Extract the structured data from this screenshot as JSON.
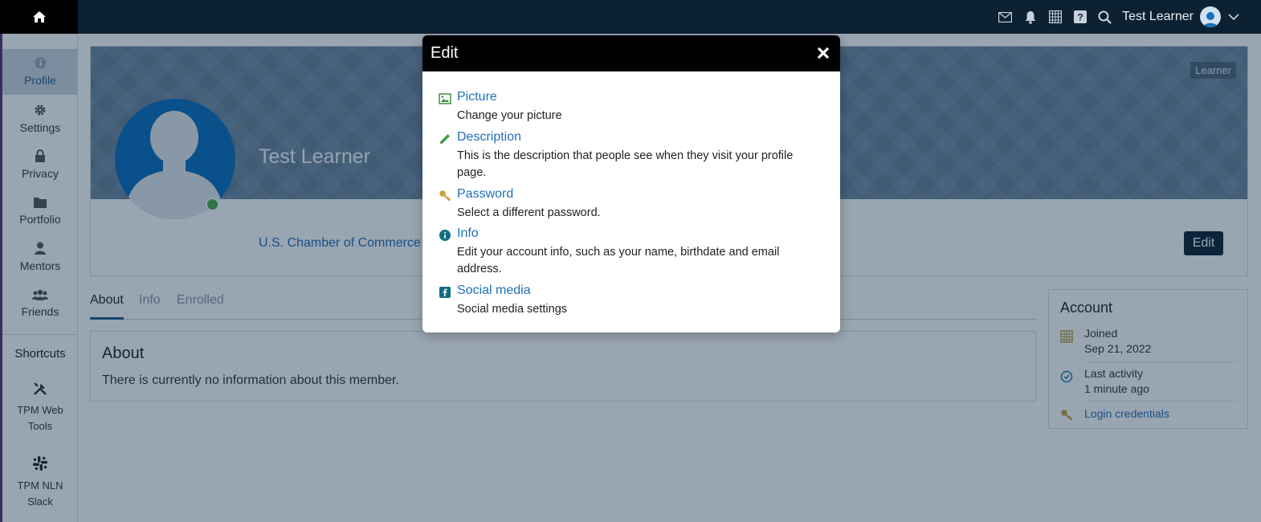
{
  "topbar": {
    "user_name": "Test Learner",
    "icons": [
      "home-icon",
      "mail-icon",
      "bell-icon",
      "calendar-icon",
      "help-icon",
      "search-icon",
      "avatar",
      "chevron-down-icon"
    ]
  },
  "sidebar": {
    "items": [
      {
        "label": "Profile",
        "icon": "info-icon"
      },
      {
        "label": "Settings",
        "icon": "gear-icon"
      },
      {
        "label": "Privacy",
        "icon": "lock-icon"
      },
      {
        "label": "Portfolio",
        "icon": "folder-icon"
      },
      {
        "label": "Mentors",
        "icon": "user-icon"
      },
      {
        "label": "Friends",
        "icon": "users-icon"
      }
    ],
    "shortcuts_title": "Shortcuts",
    "shortcuts": [
      {
        "label": "TPM Web Tools",
        "icon": "tools-icon"
      },
      {
        "label": "TPM NLN Slack",
        "icon": "slack-icon"
      }
    ]
  },
  "profile": {
    "role_badge": "Learner",
    "name": "Test Learner",
    "org": "U.S. Chamber of Commerce F",
    "edit_label": "Edit"
  },
  "tabs": [
    {
      "label": "About"
    },
    {
      "label": "Info"
    },
    {
      "label": "Enrolled"
    }
  ],
  "about": {
    "title": "About",
    "text": "There is currently no information about this member."
  },
  "account": {
    "title": "Account",
    "joined_label": "Joined",
    "joined_value": "Sep 21, 2022",
    "last_activity_label": "Last activity",
    "last_activity_value": "1 minute ago",
    "login_credentials": "Login credentials"
  },
  "modal": {
    "title": "Edit",
    "options": [
      {
        "title": "Picture",
        "desc": "Change your picture",
        "icon": "image-icon"
      },
      {
        "title": "Description",
        "desc": "This is the description that people see when they visit your profile page.",
        "icon": "pencil-icon"
      },
      {
        "title": "Password",
        "desc": "Select a different password.",
        "icon": "key-icon"
      },
      {
        "title": "Info",
        "desc": "Edit your account info, such as your name, birthdate and email address.",
        "icon": "info-icon"
      },
      {
        "title": "Social media",
        "desc": "Social media settings",
        "icon": "facebook-icon"
      }
    ]
  }
}
